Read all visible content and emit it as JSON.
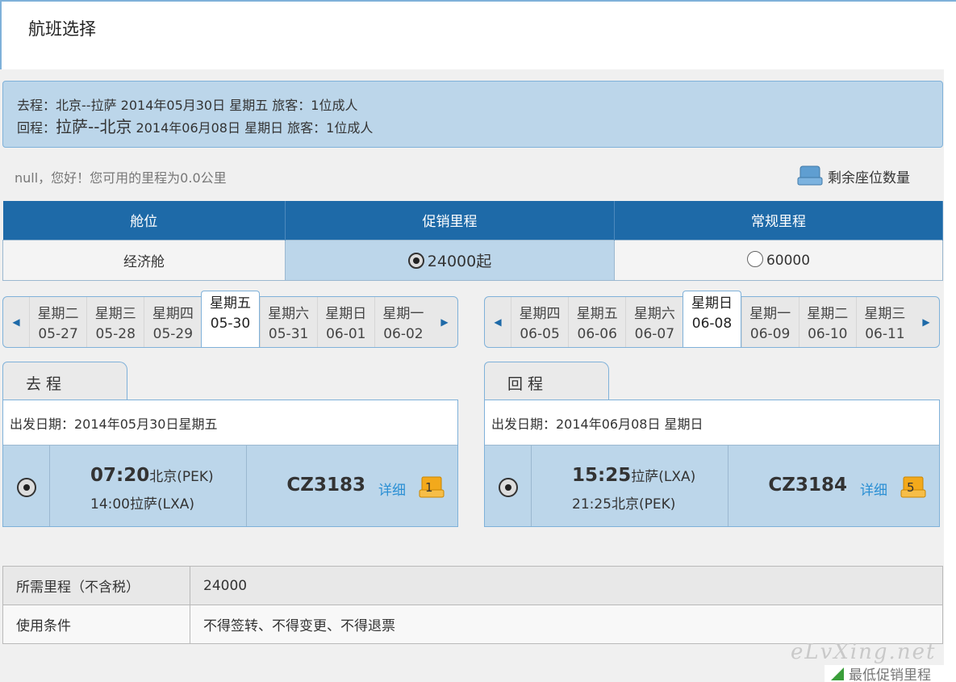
{
  "page": {
    "title": "航班选择"
  },
  "trip": {
    "outbound": {
      "label": "去程：",
      "route": "北京--拉萨",
      "date": "2014年05月30日 星期五",
      "pax": "旅客：1位成人"
    },
    "inbound": {
      "label": "回程：",
      "route": "拉萨--北京",
      "date": "2014年06月08日 星期日",
      "pax": "旅客：1位成人"
    }
  },
  "greeting": "null，您好！您可用的里程为0.0公里",
  "seat_legend": {
    "label": "剩余座位数量",
    "icon": "seat-icon"
  },
  "cabin": {
    "headers": [
      "舱位",
      "促销里程",
      "常规里程"
    ],
    "row": {
      "cabin": "经济舱",
      "promo": "24000起",
      "regular": "60000"
    }
  },
  "outbound_dates": [
    {
      "week": "星期二",
      "date": "05-27"
    },
    {
      "week": "星期三",
      "date": "05-28"
    },
    {
      "week": "星期四",
      "date": "05-29"
    },
    {
      "week": "星期五",
      "date": "05-30"
    },
    {
      "week": "星期六",
      "date": "05-31"
    },
    {
      "week": "星期日",
      "date": "06-01"
    },
    {
      "week": "星期一",
      "date": "06-02"
    }
  ],
  "inbound_dates": [
    {
      "week": "星期四",
      "date": "06-05"
    },
    {
      "week": "星期五",
      "date": "06-06"
    },
    {
      "week": "星期六",
      "date": "06-07"
    },
    {
      "week": "星期日",
      "date": "06-08"
    },
    {
      "week": "星期一",
      "date": "06-09"
    },
    {
      "week": "星期二",
      "date": "06-10"
    },
    {
      "week": "星期三",
      "date": "06-11"
    }
  ],
  "outbound_flight": {
    "tab": "去程",
    "depart_date": "出发日期：2014年05月30日星期五",
    "dep_time": "07:20",
    "dep_city": "北京(PEK)",
    "arr": "14:00拉萨(LXA)",
    "flight_no": "CZ3183",
    "detail": "详细",
    "seats": "1"
  },
  "inbound_flight": {
    "tab": "回程",
    "depart_date": "出发日期：2014年06月08日 星期日",
    "dep_time": "15:25",
    "dep_city": "拉萨(LXA)",
    "arr": "21:25北京(PEK)",
    "flight_no": "CZ3184",
    "detail": "详细",
    "seats": "5"
  },
  "summary": {
    "miles_label": "所需里程（不含税）",
    "miles_value": "24000",
    "terms_label": "使用条件",
    "terms_value": "不得签转、不得变更、不得退票"
  },
  "watermark": "eLvXing.net",
  "legend_lowest": "最低促销里程",
  "colors": {
    "header_blue": "#1e6aa8",
    "light_blue": "#bcd6ea",
    "link": "#2a8fd4",
    "seat_orange": "#f3a91b"
  }
}
